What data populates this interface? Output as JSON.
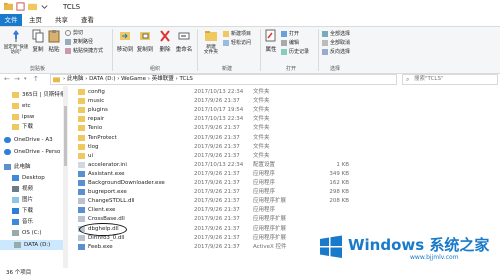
{
  "window": {
    "title": "TCLS"
  },
  "menu": {
    "file": "文件",
    "home": "主页",
    "share": "共享",
    "view": "查看"
  },
  "ribbon": {
    "pin": "固定到\"快速访问\"",
    "copy": "复制",
    "paste": "粘贴",
    "cut": "剪切",
    "copy_path": "复制路径",
    "paste_shortcut": "粘贴快捷方式",
    "move_to": "移动到",
    "copy_to": "复制到",
    "delete": "删除",
    "rename": "重命名",
    "new_folder": "新建\n文件夹",
    "new_item": "新建项目",
    "easy_access": "轻松访问",
    "properties": "属性",
    "open": "打开",
    "edit": "编辑",
    "history": "历史记录",
    "select_all": "全部选择",
    "select_none": "全部取消",
    "invert": "反向选择",
    "groups": {
      "clipboard": "剪贴板",
      "organize": "组织",
      "new": "新建",
      "open": "打开",
      "select": "选择"
    }
  },
  "address": {
    "crumbs": [
      "此电脑",
      "DATA (D:)",
      "WeGame",
      "英雄联盟",
      "TCLS"
    ],
    "search_placeholder": "搜索\"TCLS\""
  },
  "sidebar": {
    "items": [
      {
        "label": "365日 | 贝斯特条",
        "icon": "folder-icon"
      },
      {
        "label": "etc",
        "icon": "folder-icon"
      },
      {
        "label": "ipsw",
        "icon": "folder-icon"
      },
      {
        "label": "下载",
        "icon": "folder-icon"
      },
      {
        "label": "OneDrive - A3",
        "icon": "cloud-icon"
      },
      {
        "label": "OneDrive - Perso",
        "icon": "cloud-icon"
      },
      {
        "label": "此电脑",
        "icon": "pc-icon"
      },
      {
        "label": "Desktop",
        "icon": "desktop-icon"
      },
      {
        "label": "视频",
        "icon": "video-icon"
      },
      {
        "label": "图片",
        "icon": "image-icon"
      },
      {
        "label": "下载",
        "icon": "download-icon"
      },
      {
        "label": "音乐",
        "icon": "music-icon"
      },
      {
        "label": "OS (C:)",
        "icon": "drive-icon"
      },
      {
        "label": "DATA (D:)",
        "icon": "drive-icon"
      }
    ]
  },
  "files": [
    {
      "name": "config",
      "date": "2017/10/13 22:34",
      "type": "文件夹",
      "size": "",
      "kind": "folder"
    },
    {
      "name": "music",
      "date": "2017/9/26 21:37",
      "type": "文件夹",
      "size": "",
      "kind": "folder"
    },
    {
      "name": "plugins",
      "date": "2017/10/17 19:54",
      "type": "文件夹",
      "size": "",
      "kind": "folder"
    },
    {
      "name": "repair",
      "date": "2017/10/13 22:34",
      "type": "文件夹",
      "size": "",
      "kind": "folder"
    },
    {
      "name": "Tenio",
      "date": "2017/9/26 21:37",
      "type": "文件夹",
      "size": "",
      "kind": "folder"
    },
    {
      "name": "TenProtect",
      "date": "2017/9/26 21:37",
      "type": "文件夹",
      "size": "",
      "kind": "folder"
    },
    {
      "name": "tlog",
      "date": "2017/9/26 21:37",
      "type": "文件夹",
      "size": "",
      "kind": "folder"
    },
    {
      "name": "ui",
      "date": "2017/9/26 21:37",
      "type": "文件夹",
      "size": "",
      "kind": "folder"
    },
    {
      "name": "accelerator.ini",
      "date": "2017/10/13 22:34",
      "type": "配置设置",
      "size": "1 KB",
      "kind": "ini"
    },
    {
      "name": "Assistant.exe",
      "date": "2017/9/26 21:37",
      "type": "应用程序",
      "size": "349 KB",
      "kind": "exe"
    },
    {
      "name": "BackgroundDownloader.exe",
      "date": "2017/9/26 21:37",
      "type": "应用程序",
      "size": "162 KB",
      "kind": "exe"
    },
    {
      "name": "bugreport.exe",
      "date": "2017/9/26 21:37",
      "type": "应用程序",
      "size": "298 KB",
      "kind": "exe"
    },
    {
      "name": "ChangeSTDLL.dll",
      "date": "2017/9/26 21:37",
      "type": "应用程序扩展",
      "size": "208 KB",
      "kind": "dll"
    },
    {
      "name": "Client.exe",
      "date": "2017/9/26 21:37",
      "type": "应用程序",
      "size": "",
      "kind": "exe"
    },
    {
      "name": "CrossBase.dll",
      "date": "2017/9/26 21:37",
      "type": "应用程序扩展",
      "size": "",
      "kind": "dll"
    },
    {
      "name": "dbghelp.dll",
      "date": "2017/9/26 21:37",
      "type": "应用程序扩展",
      "size": "",
      "kind": "dll"
    },
    {
      "name": "DirInfo3_0.dll",
      "date": "2017/9/26 21:37",
      "type": "应用程序扩展",
      "size": "",
      "kind": "dll"
    },
    {
      "name": "Feeb.exe",
      "date": "2017/9/26 21:37",
      "type": "ActiveX 控件",
      "size": "",
      "kind": "exe"
    }
  ],
  "status": {
    "count": "36 个项目"
  },
  "watermark": {
    "text": "Windows 系统之家",
    "url": "www.bjjmlv.com"
  },
  "colors": {
    "accent": "#1979ca",
    "selection": "#cce8ff"
  }
}
